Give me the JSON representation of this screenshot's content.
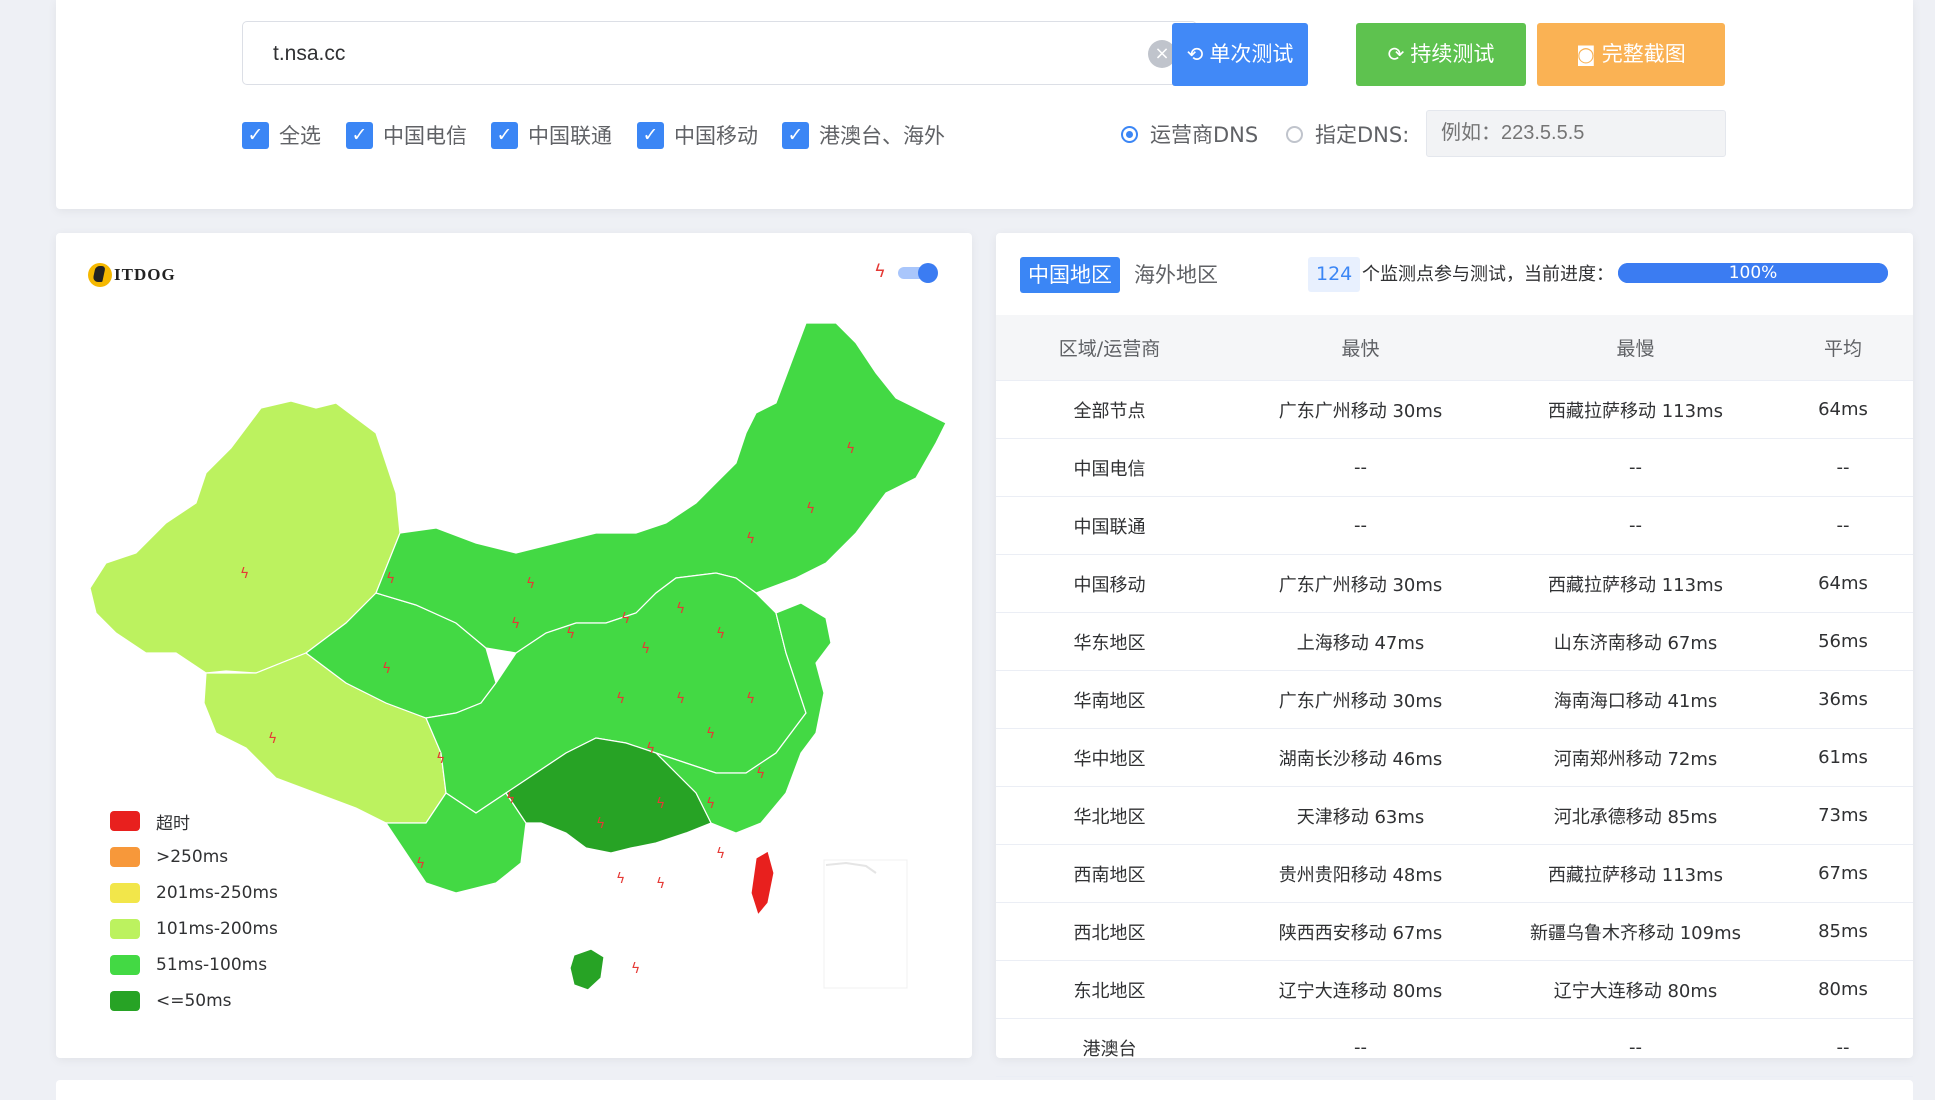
{
  "search": {
    "value": "t.nsa.cc"
  },
  "buttons": {
    "single": "单次测试",
    "continuous": "持续测试",
    "screenshot": "完整截图"
  },
  "filters": [
    {
      "label": "全选",
      "checked": true
    },
    {
      "label": "中国电信",
      "checked": true
    },
    {
      "label": "中国联通",
      "checked": true
    },
    {
      "label": "中国移动",
      "checked": true
    },
    {
      "label": "港澳台、海外",
      "checked": true
    }
  ],
  "dns": {
    "operator_label": "运营商DNS",
    "custom_label": "指定DNS:",
    "selected": "运营商DNS",
    "placeholder": "例如：223.5.5.5"
  },
  "map": {
    "logo_text": "ITDOG",
    "legend": [
      {
        "label": "超时",
        "color": "#e8201e"
      },
      {
        "label": ">250ms",
        "color": "#f7983a"
      },
      {
        "label": "201ms-250ms",
        "color": "#f2e64a"
      },
      {
        "label": "101ms-200ms",
        "color": "#bcf25f"
      },
      {
        "label": "51ms-100ms",
        "color": "#43d944"
      },
      {
        "label": "<=50ms",
        "color": "#27a325"
      }
    ]
  },
  "results": {
    "tabs": [
      "中国地区",
      "海外地区"
    ],
    "active_tab": "中国地区",
    "node_count": "124",
    "progress_text": "个监测点参与测试，当前进度：",
    "progress": "100%",
    "headers": [
      "区域/运营商",
      "最快",
      "最慢",
      "平均"
    ],
    "rows": [
      [
        "全部节点",
        "广东广州移动 30ms",
        "西藏拉萨移动 113ms",
        "64ms"
      ],
      [
        "中国电信",
        "--",
        "--",
        "--"
      ],
      [
        "中国联通",
        "--",
        "--",
        "--"
      ],
      [
        "中国移动",
        "广东广州移动 30ms",
        "西藏拉萨移动 113ms",
        "64ms"
      ],
      [
        "华东地区",
        "上海移动 47ms",
        "山东济南移动 67ms",
        "56ms"
      ],
      [
        "华南地区",
        "广东广州移动 30ms",
        "海南海口移动 41ms",
        "36ms"
      ],
      [
        "华中地区",
        "湖南长沙移动 46ms",
        "河南郑州移动 72ms",
        "61ms"
      ],
      [
        "华北地区",
        "天津移动 63ms",
        "河北承德移动 85ms",
        "73ms"
      ],
      [
        "西南地区",
        "贵州贵阳移动 48ms",
        "西藏拉萨移动 113ms",
        "67ms"
      ],
      [
        "西北地区",
        "陕西西安移动 67ms",
        "新疆乌鲁木齐移动 109ms",
        "85ms"
      ],
      [
        "东北地区",
        "辽宁大连移动 80ms",
        "辽宁大连移动 80ms",
        "80ms"
      ],
      [
        "港澳台",
        "--",
        "--",
        "--"
      ]
    ]
  }
}
